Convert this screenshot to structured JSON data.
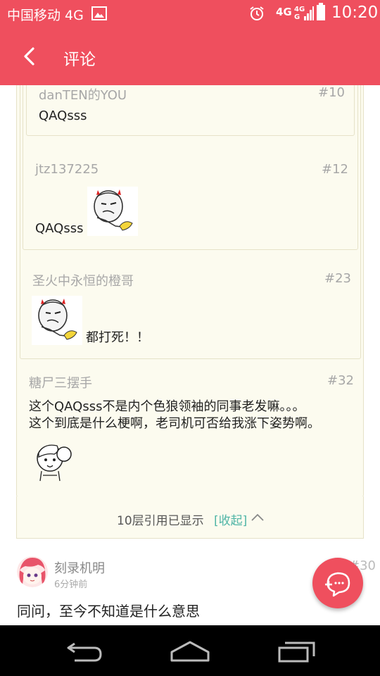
{
  "status_bar": {
    "carrier": "中国移动 4G",
    "network": "4G",
    "network_small_top": "4G",
    "network_small_bottom": "G",
    "time": "10:20"
  },
  "app_bar": {
    "title": "评论",
    "back_icon": "chevron-left-icon"
  },
  "quotes": [
    {
      "user": "danTEN的YOU",
      "floor": "#10",
      "text": "QAQsss"
    },
    {
      "user": "jtz137225",
      "floor": "#12",
      "text": "QAQsss",
      "sticker": "meme-face-sticker"
    },
    {
      "user": "圣火中永恒的橙哥",
      "floor": "#23",
      "text": "都打死！！",
      "sticker": "meme-face-sticker"
    },
    {
      "user": "糖尸三摆手",
      "floor": "#32",
      "lines": [
        "这个QAQsss不是内个色狼领袖的同事老发嘛。。。",
        "这个到底是什么梗啊，老司机可否给我涨下姿势啊。"
      ],
      "sticker": "anime-girl-sticker"
    }
  ],
  "quote_footer": {
    "text": "10层引用已显示",
    "toggle_label": "[收起]",
    "toggle_icon": "chevron-up-icon"
  },
  "comment": {
    "user": "刻录机明",
    "time": "6分钟前",
    "floor": "#30",
    "body": "同问，至今不知道是什么意思",
    "avatar": "avatar-icon"
  },
  "fab_icon": "comment-plus-icon",
  "colors": {
    "accent": "#ef4f5e",
    "quote_bg": "#fcfbef",
    "link": "#4fb5a6",
    "muted_text": "#a7a7a7"
  }
}
